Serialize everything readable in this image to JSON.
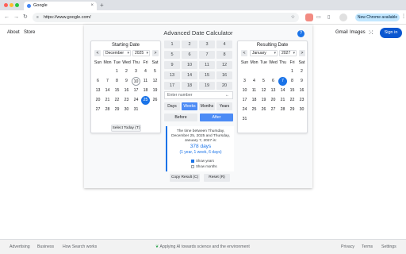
{
  "browser": {
    "tab_title": "Google",
    "tab_close": "×",
    "new_tab": "+",
    "url": "https://www.google.com/",
    "update_label": "New Chrome available",
    "nav": {
      "back": "←",
      "forward": "→",
      "reload": "↻"
    },
    "menu": "⋮"
  },
  "header": {
    "about": "About",
    "store": "Store",
    "gmail": "Gmail",
    "images": "Images",
    "sign_in": "Sign in"
  },
  "calculator": {
    "title": "Advanced Date Calculator",
    "help": "?",
    "weekdays": [
      "Sun",
      "Mon",
      "Tue",
      "Wed",
      "Thu",
      "Fri",
      "Sat"
    ],
    "prev": "<",
    "next": ">",
    "dropdown": "▾",
    "start": {
      "title": "Starting Date",
      "month": "December",
      "year": "2025",
      "weeks": [
        [
          "",
          "",
          "1",
          "2",
          "3",
          "4",
          "5"
        ],
        [
          "6",
          "7",
          "8",
          "9",
          "10",
          "11",
          "12"
        ],
        [
          "13",
          "14",
          "15",
          "16",
          "17",
          "18",
          "19"
        ],
        [
          "20",
          "21",
          "22",
          "23",
          "24",
          "25",
          "26"
        ],
        [
          "27",
          "28",
          "29",
          "30",
          "31",
          "",
          ""
        ]
      ],
      "today": "10",
      "selected": "25",
      "select_today": "Select Today (T)"
    },
    "end": {
      "title": "Resulting Date",
      "month": "January",
      "year": "2027",
      "weeks": [
        [
          "",
          "",
          "",
          "",
          "",
          "1",
          "2"
        ],
        [
          "3",
          "4",
          "5",
          "6",
          "7",
          "8",
          "9"
        ],
        [
          "10",
          "11",
          "12",
          "13",
          "14",
          "15",
          "16"
        ],
        [
          "17",
          "18",
          "19",
          "20",
          "21",
          "22",
          "23"
        ],
        [
          "24",
          "25",
          "26",
          "27",
          "28",
          "29",
          "30"
        ],
        [
          "31",
          "",
          "",
          "",
          "",
          "",
          ""
        ]
      ],
      "selected": "7"
    },
    "keypad": [
      "1",
      "2",
      "3",
      "4",
      "5",
      "6",
      "7",
      "8",
      "9",
      "10",
      "11",
      "12",
      "13",
      "14",
      "15",
      "16",
      "17",
      "18",
      "19",
      "20"
    ],
    "number_placeholder": "Enter number",
    "backspace": "←",
    "units": [
      "Days",
      "Weeks",
      "Months",
      "Years"
    ],
    "active_unit": "Weeks",
    "before": "Before",
    "after": "After",
    "result": {
      "line1": "The time between Thursday,",
      "line2": "December 25, 2025 and Thursday,",
      "line3": "January 7, 2027 is:",
      "days": "378 days",
      "detail": "(1 year, 1 week, 6 days)",
      "show_years": "Show years",
      "show_months": "Show months"
    },
    "copy": "Copy Result (C)",
    "reset": "Reset (R)"
  },
  "footer": {
    "left": [
      "Advertising",
      "Business",
      "How Search works"
    ],
    "center": "Applying AI towards science and the environment",
    "right": [
      "Privacy",
      "Terms",
      "Settings"
    ]
  },
  "colors": {
    "accent": "#1a73e8",
    "sign_in": "#0b57d0",
    "chrome_pill": "#c2e7ff"
  }
}
